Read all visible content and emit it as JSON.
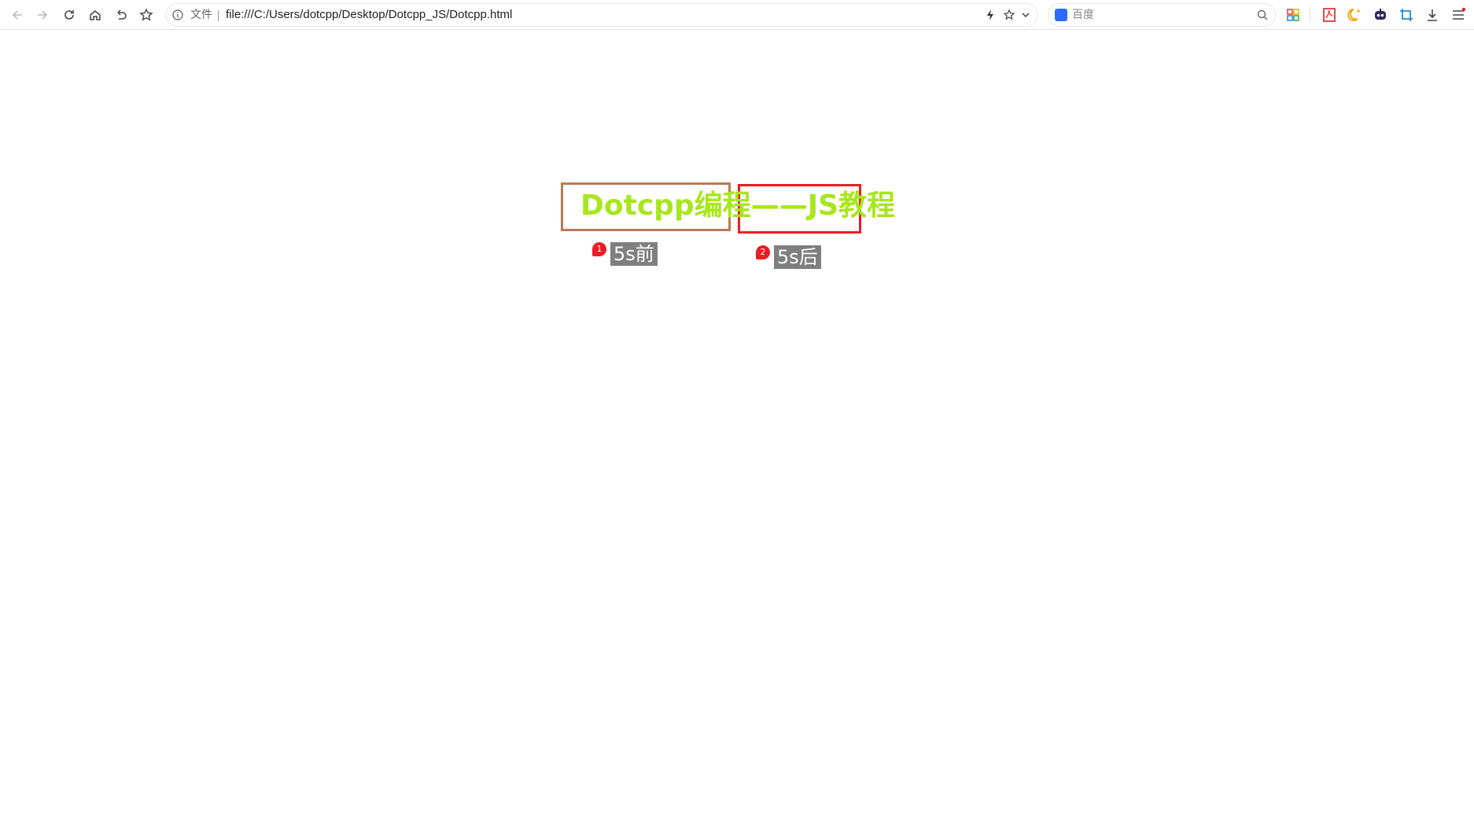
{
  "browser": {
    "address_file_label": "文件",
    "url": "file:///C:/Users/dotcpp/Desktop/Dotcpp_JS/Dotcpp.html",
    "search_placeholder": "百度",
    "icons": {
      "back": "arrow-left-icon",
      "forward": "arrow-right-icon",
      "reload": "reload-icon",
      "home": "home-icon",
      "undo": "undo-icon",
      "bookmark": "star-icon",
      "info": "info-icon",
      "lightning": "lightning-icon",
      "favorite": "star-outline-icon",
      "dropdown": "chevron-down-icon",
      "search": "magnifier-icon",
      "apps": "apps-grid-icon",
      "pdf": "pdf-icon",
      "night_mode": "moon-icon",
      "robot": "robot-icon",
      "crop": "crop-icon",
      "download": "download-icon",
      "menu": "menu-icon"
    }
  },
  "page": {
    "title": "Dotcpp编程——JS教程",
    "title_color": "#a8e61d",
    "left_box_color": "#b97a56",
    "right_box_color": "#ed1c24",
    "markers": [
      {
        "number": "1",
        "label": "5s前"
      },
      {
        "number": "2",
        "label": "5s后"
      }
    ]
  }
}
